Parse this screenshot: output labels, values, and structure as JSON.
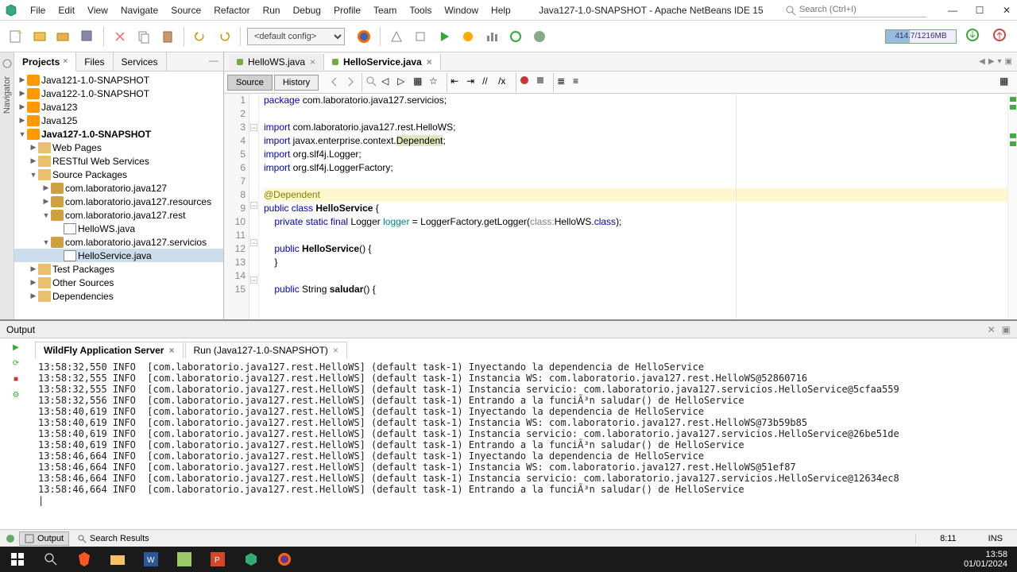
{
  "menubar": {
    "items": [
      "File",
      "Edit",
      "View",
      "Navigate",
      "Source",
      "Refactor",
      "Run",
      "Debug",
      "Profile",
      "Team",
      "Tools",
      "Window",
      "Help"
    ],
    "title": "Java127-1.0-SNAPSHOT - Apache NetBeans IDE 15",
    "search_placeholder": "Search (Ctrl+I)"
  },
  "toolbar": {
    "config_selected": "<default config>",
    "memory": "414.7/1216MB"
  },
  "projects_panel": {
    "tabs": [
      "Projects",
      "Files",
      "Services"
    ],
    "tree": [
      {
        "level": 0,
        "icon": "proj",
        "label": "Java121-1.0-SNAPSHOT",
        "twist": "▶"
      },
      {
        "level": 0,
        "icon": "proj",
        "label": "Java122-1.0-SNAPSHOT",
        "twist": "▶"
      },
      {
        "level": 0,
        "icon": "proj",
        "label": "Java123",
        "twist": "▶"
      },
      {
        "level": 0,
        "icon": "proj",
        "label": "Java125",
        "twist": "▶"
      },
      {
        "level": 0,
        "icon": "proj",
        "label": "Java127-1.0-SNAPSHOT",
        "twist": "▼",
        "bold": true
      },
      {
        "level": 1,
        "icon": "folder",
        "label": "Web Pages",
        "twist": "▶"
      },
      {
        "level": 1,
        "icon": "folder",
        "label": "RESTful Web Services",
        "twist": "▶"
      },
      {
        "level": 1,
        "icon": "folder",
        "label": "Source Packages",
        "twist": "▼"
      },
      {
        "level": 2,
        "icon": "pkg",
        "label": "com.laboratorio.java127",
        "twist": "▶"
      },
      {
        "level": 2,
        "icon": "pkg",
        "label": "com.laboratorio.java127.resources",
        "twist": "▶"
      },
      {
        "level": 2,
        "icon": "pkg",
        "label": "com.laboratorio.java127.rest",
        "twist": "▼"
      },
      {
        "level": 3,
        "icon": "java",
        "label": "HelloWS.java",
        "twist": ""
      },
      {
        "level": 2,
        "icon": "pkg",
        "label": "com.laboratorio.java127.servicios",
        "twist": "▼"
      },
      {
        "level": 3,
        "icon": "java",
        "label": "HelloService.java",
        "twist": "",
        "selected": true
      },
      {
        "level": 1,
        "icon": "folder",
        "label": "Test Packages",
        "twist": "▶"
      },
      {
        "level": 1,
        "icon": "folder",
        "label": "Other Sources",
        "twist": "▶"
      },
      {
        "level": 1,
        "icon": "folder",
        "label": "Dependencies",
        "twist": "▶"
      }
    ]
  },
  "editor": {
    "tabs": [
      {
        "label": "HelloWS.java",
        "active": false
      },
      {
        "label": "HelloService.java",
        "active": true
      }
    ],
    "views": {
      "source": "Source",
      "history": "History"
    },
    "code_lines": [
      {
        "n": 1,
        "html": "<span class='kw'>package</span> com.laboratorio.java127.servicios;"
      },
      {
        "n": 2,
        "html": ""
      },
      {
        "n": 3,
        "html": "<span class='kw'>import</span> com.laboratorio.java127.rest.HelloWS;",
        "fold": "−"
      },
      {
        "n": 4,
        "html": "<span class='kw'>import</span> javax.enterprise.context.<span class='hl-dep'>Dependent</span>;"
      },
      {
        "n": 5,
        "html": "<span class='kw'>import</span> org.slf4j.Logger;"
      },
      {
        "n": 6,
        "html": "<span class='kw'>import</span> org.slf4j.LoggerFactory;"
      },
      {
        "n": 7,
        "html": ""
      },
      {
        "n": 8,
        "html": "<span class='hl-bg'><span class='ann'>@Dependent</span></span>"
      },
      {
        "n": 9,
        "html": "<span class='kw'>public class</span> <span class='cls'>HelloService</span> {",
        "fold": "−"
      },
      {
        "n": 10,
        "html": "    <span class='kw'>private static final</span> Logger <span style='color:#088'>logger</span> = LoggerFactory.getLogger(<span class='logname'>class:</span>HelloWS.<span class='kw'>class</span>);"
      },
      {
        "n": 11,
        "html": ""
      },
      {
        "n": 12,
        "html": "    <span class='kw'>public</span> <span class='cls'>HelloService</span>() {",
        "fold": "−"
      },
      {
        "n": 13,
        "html": "    }"
      },
      {
        "n": 14,
        "html": ""
      },
      {
        "n": 15,
        "html": "    <span class='kw'>public</span> String <span class='cls'>saludar</span>() {",
        "fold": "−"
      }
    ]
  },
  "output": {
    "title": "Output",
    "tabs": [
      {
        "label": "WildFly Application Server",
        "active": true
      },
      {
        "label": "Run (Java127-1.0-SNAPSHOT)",
        "active": false
      }
    ],
    "lines": [
      "13:58:32,550 INFO  [com.laboratorio.java127.rest.HelloWS] (default task-1) Inyectando la dependencia de HelloService",
      "13:58:32,555 INFO  [com.laboratorio.java127.rest.HelloWS] (default task-1) Instancia WS: com.laboratorio.java127.rest.HelloWS@52860716",
      "13:58:32,555 INFO  [com.laboratorio.java127.rest.HelloWS] (default task-1) Instancia servicio: com.laboratorio.java127.servicios.HelloService@5cfaa559",
      "13:58:32,556 INFO  [com.laboratorio.java127.rest.HelloWS] (default task-1) Entrando a la funciÃ³n saludar() de HelloService",
      "13:58:40,619 INFO  [com.laboratorio.java127.rest.HelloWS] (default task-1) Inyectando la dependencia de HelloService",
      "13:58:40,619 INFO  [com.laboratorio.java127.rest.HelloWS] (default task-1) Instancia WS: com.laboratorio.java127.rest.HelloWS@73b59b85",
      "13:58:40,619 INFO  [com.laboratorio.java127.rest.HelloWS] (default task-1) Instancia servicio: com.laboratorio.java127.servicios.HelloService@26be51de",
      "13:58:40,619 INFO  [com.laboratorio.java127.rest.HelloWS] (default task-1) Entrando a la funciÃ³n saludar() de HelloService",
      "13:58:46,664 INFO  [com.laboratorio.java127.rest.HelloWS] (default task-1) Inyectando la dependencia de HelloService",
      "13:58:46,664 INFO  [com.laboratorio.java127.rest.HelloWS] (default task-1) Instancia WS: com.laboratorio.java127.rest.HelloWS@51ef87",
      "13:58:46,664 INFO  [com.laboratorio.java127.rest.HelloWS] (default task-1) Instancia servicio: com.laboratorio.java127.servicios.HelloService@12634ec8",
      "13:58:46,664 INFO  [com.laboratorio.java127.rest.HelloWS] (default task-1) Entrando a la funciÃ³n saludar() de HelloService"
    ]
  },
  "bottom_tabs": {
    "output": "Output",
    "search": "Search Results"
  },
  "status": {
    "cursor": "8:11",
    "mode": "INS"
  },
  "taskbar": {
    "date": "01/01/2024",
    "time": "13:58"
  },
  "navigator_label": "Navigator"
}
